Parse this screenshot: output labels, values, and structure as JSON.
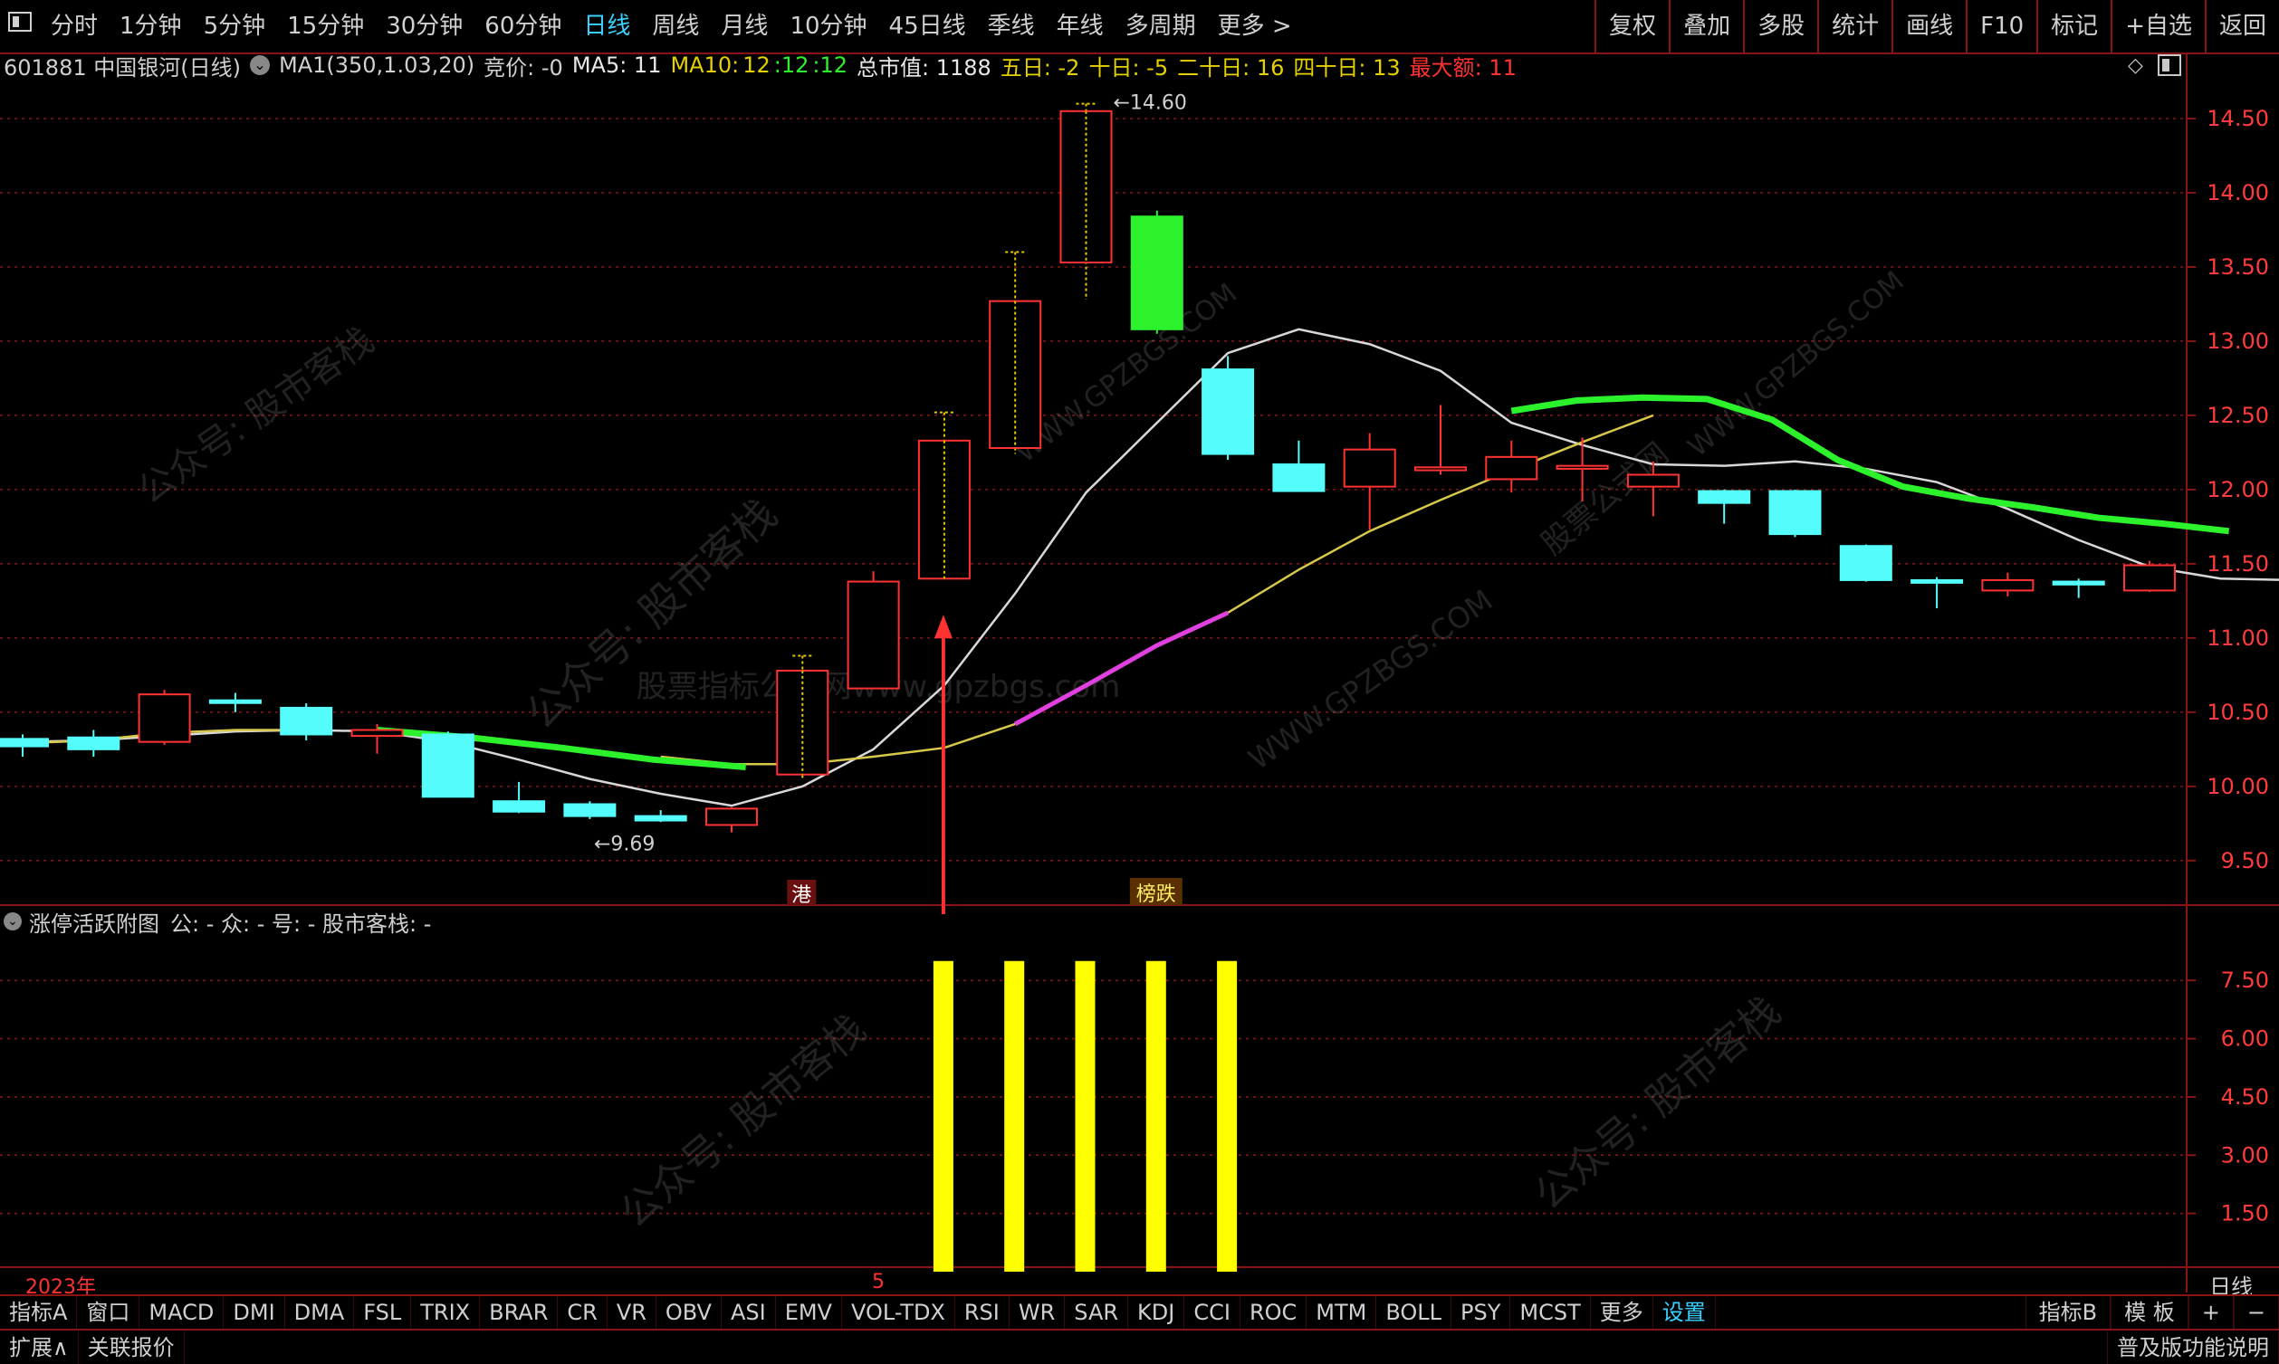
{
  "toolbar": {
    "left_icon": "window-menu-icon",
    "periods": [
      "分时",
      "1分钟",
      "5分钟",
      "15分钟",
      "30分钟",
      "60分钟",
      "日线",
      "周线",
      "月线",
      "10分钟",
      "45日线",
      "季线",
      "年线",
      "多周期",
      "更多 >"
    ],
    "active_period": "日线",
    "right_buttons": [
      "复权",
      "叠加",
      "多股",
      "统计",
      "画线",
      "F10",
      "标记",
      "+自选",
      "返回"
    ]
  },
  "info": {
    "stock": "601881 中国银河(日线)",
    "ma_param": "MA1(350,1.03,20)",
    "auction": "竞价: -0",
    "ma5": "MA5: 11",
    "ma10_label": "MA10:",
    "ma10_v1": "12",
    "ma10_v2": ":12",
    "ma10_v3": ":12",
    "mktcap": "总市值: 1188",
    "d5": "五日: -2",
    "d10": "十日: -5",
    "d20": "二十日: 16",
    "d40": "四十日: 13",
    "maxamt": "最大额: 11"
  },
  "indicator": {
    "title": "涨停活跃附图",
    "params": "公: -  众: -  号: -  股市客栈: -"
  },
  "axis": {
    "year_label": "2023年",
    "month_label": "5",
    "period_box": "日线"
  },
  "chart_data": [
    {
      "type": "candlestick",
      "title": "601881 中国银河(日线)",
      "ylim": [
        9.2,
        14.75
      ],
      "yticks": [
        9.5,
        10.0,
        10.5,
        11.0,
        11.5,
        12.0,
        12.5,
        13.0,
        13.5,
        14.0,
        14.5
      ],
      "grid": true,
      "annotations": {
        "high_label": "14.60",
        "low_label": "9.69",
        "marker_hk": "港",
        "marker_list": "榜跌"
      },
      "candles": [
        {
          "o": 10.32,
          "c": 10.27,
          "h": 10.35,
          "l": 10.2,
          "t": "down"
        },
        {
          "o": 10.33,
          "c": 10.25,
          "h": 10.38,
          "l": 10.2,
          "t": "down"
        },
        {
          "o": 10.3,
          "c": 10.62,
          "h": 10.65,
          "l": 10.28,
          "t": "up"
        },
        {
          "o": 10.57,
          "c": 10.58,
          "h": 10.63,
          "l": 10.5,
          "t": "doji"
        },
        {
          "o": 10.53,
          "c": 10.35,
          "h": 10.56,
          "l": 10.31,
          "t": "down"
        },
        {
          "o": 10.38,
          "c": 10.34,
          "h": 10.42,
          "l": 10.22,
          "t": "up"
        },
        {
          "o": 10.35,
          "c": 9.93,
          "h": 10.37,
          "l": 9.93,
          "t": "down"
        },
        {
          "o": 9.9,
          "c": 9.83,
          "h": 10.03,
          "l": 9.82,
          "t": "down"
        },
        {
          "o": 9.88,
          "c": 9.8,
          "h": 9.9,
          "l": 9.78,
          "t": "down"
        },
        {
          "o": 9.8,
          "c": 9.77,
          "h": 9.84,
          "l": 9.76,
          "t": "down"
        },
        {
          "o": 9.74,
          "c": 9.85,
          "h": 9.86,
          "l": 9.69,
          "t": "up"
        },
        {
          "o": 10.08,
          "c": 10.78,
          "h": 10.88,
          "l": 10.05,
          "t": "limit"
        },
        {
          "o": 10.66,
          "c": 11.38,
          "h": 11.45,
          "l": 10.66,
          "t": "up"
        },
        {
          "o": 11.4,
          "c": 12.33,
          "h": 12.52,
          "l": 11.4,
          "t": "limit"
        },
        {
          "o": 12.28,
          "c": 13.27,
          "h": 13.6,
          "l": 12.24,
          "t": "limit"
        },
        {
          "o": 13.53,
          "c": 14.55,
          "h": 14.6,
          "l": 13.28,
          "t": "limit"
        },
        {
          "o": 13.84,
          "c": 13.08,
          "h": 13.88,
          "l": 13.05,
          "t": "green"
        },
        {
          "o": 12.81,
          "c": 12.24,
          "h": 12.9,
          "l": 12.2,
          "t": "down"
        },
        {
          "o": 12.17,
          "c": 11.99,
          "h": 12.33,
          "l": 11.99,
          "t": "down"
        },
        {
          "o": 12.02,
          "c": 12.27,
          "h": 12.38,
          "l": 11.73,
          "t": "up"
        },
        {
          "o": 12.13,
          "c": 12.15,
          "h": 12.57,
          "l": 12.1,
          "t": "up"
        },
        {
          "o": 12.07,
          "c": 12.22,
          "h": 12.33,
          "l": 11.98,
          "t": "up"
        },
        {
          "o": 12.14,
          "c": 12.16,
          "h": 12.35,
          "l": 11.92,
          "t": "up"
        },
        {
          "o": 12.02,
          "c": 12.1,
          "h": 12.19,
          "l": 11.82,
          "t": "up"
        },
        {
          "o": 11.99,
          "c": 11.91,
          "h": 12.0,
          "l": 11.77,
          "t": "down"
        },
        {
          "o": 11.99,
          "c": 11.7,
          "h": 12.0,
          "l": 11.68,
          "t": "down"
        },
        {
          "o": 11.62,
          "c": 11.39,
          "h": 11.63,
          "l": 11.38,
          "t": "down"
        },
        {
          "o": 11.39,
          "c": 11.38,
          "h": 11.41,
          "l": 11.2,
          "t": "doji"
        },
        {
          "o": 11.32,
          "c": 11.39,
          "h": 11.44,
          "l": 11.28,
          "t": "up"
        },
        {
          "o": 11.36,
          "c": 11.38,
          "h": 11.4,
          "l": 11.27,
          "t": "down"
        },
        {
          "o": 11.32,
          "c": 11.49,
          "h": 11.52,
          "l": 11.31,
          "t": "up"
        }
      ],
      "ma_white": [
        10.3,
        10.31,
        10.34,
        10.37,
        10.38,
        10.37,
        10.3,
        10.18,
        10.05,
        9.95,
        9.87,
        10.0,
        10.25,
        10.68,
        11.3,
        11.98,
        12.45,
        12.92,
        13.08,
        12.98,
        12.8,
        12.45,
        12.3,
        12.17,
        12.16,
        12.19,
        12.14,
        12.05,
        11.87,
        11.66,
        11.48,
        11.4,
        11.39
      ],
      "ma_yellow": [
        10.29,
        10.31,
        10.36,
        10.38,
        10.38,
        10.37,
        10.34,
        10.3,
        10.25,
        10.2,
        10.15,
        10.15,
        10.2,
        10.26,
        10.42,
        10.68,
        10.95,
        11.17,
        11.46,
        11.72,
        11.93,
        12.13,
        12.32,
        12.5
      ],
      "green_thick": [
        [
          10.38,
          10.33,
          10.26,
          10.18,
          10.13
        ],
        [
          12.53,
          12.6,
          12.62,
          12.61,
          12.47,
          12.2,
          12.02,
          11.94,
          11.88,
          11.81,
          11.77,
          11.72
        ]
      ]
    },
    {
      "type": "bar",
      "title": "涨停活跃附图",
      "ylim": [
        0,
        8.6
      ],
      "yticks": [
        1.5,
        3.0,
        4.5,
        6.0,
        7.5
      ],
      "bars": [
        {
          "i": 13,
          "v": 8
        },
        {
          "i": 14,
          "v": 8
        },
        {
          "i": 15,
          "v": 8
        },
        {
          "i": 16,
          "v": 8
        },
        {
          "i": 17,
          "v": 8
        }
      ]
    }
  ],
  "indicator_tabs": [
    "指标A",
    "窗口",
    "MACD",
    "DMI",
    "DMA",
    "FSL",
    "TRIX",
    "BRAR",
    "CR",
    "VR",
    "OBV",
    "ASI",
    "EMV",
    "VOL-TDX",
    "RSI",
    "WR",
    "SAR",
    "KDJ",
    "CCI",
    "ROC",
    "MTM",
    "BOLL",
    "PSY",
    "MCST",
    "更多",
    "设置"
  ],
  "active_tab": "设置",
  "bottom_right": [
    "指标B",
    "模 板",
    "+",
    "−"
  ],
  "status": {
    "expand": "扩展∧",
    "quote": "关联报价",
    "right": "普及版功能说明"
  },
  "watermarks": [
    "公众号: 股市客栈",
    "股票指标公式网www.gpzbgs.com",
    "WWW.GPZBGS.COM",
    "股市客栈",
    "股票公式网"
  ],
  "colors": {
    "up": "#ff3232",
    "down": "#54fcfc",
    "limit_wick": "#e5c800",
    "green": "#2cf22c",
    "ma_white": "#d8d8d8",
    "ma_yellow": "#d8c84a",
    "ma_magenta": "#e040e0",
    "ind_bar": "#ffff00",
    "grid": "#8a1414"
  }
}
